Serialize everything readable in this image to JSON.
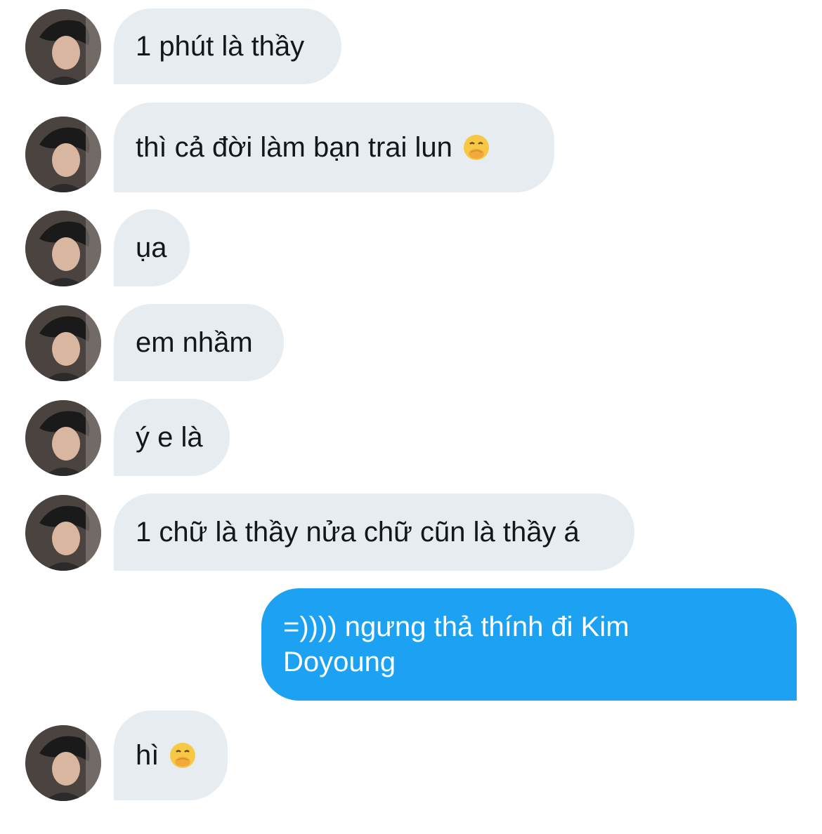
{
  "messages": [
    {
      "sender": "them",
      "text": "1 phút là thầy",
      "emoji": null
    },
    {
      "sender": "them",
      "text": "thì cả đời làm bạn trai lun",
      "emoji": "hand-over-mouth-emoji"
    },
    {
      "sender": "them",
      "text": "ụa",
      "emoji": null
    },
    {
      "sender": "them",
      "text": "em nhầm",
      "emoji": null
    },
    {
      "sender": "them",
      "text": "ý e là",
      "emoji": null
    },
    {
      "sender": "them",
      "text": "1 chữ là thầy nửa chữ cũn là thầy á",
      "emoji": null
    },
    {
      "sender": "me",
      "text": "=)))) ngưng thả thính đi Kim Doyoung",
      "emoji": null
    },
    {
      "sender": "them",
      "text": "hì",
      "emoji": "hand-over-mouth-emoji"
    }
  ],
  "colors": {
    "incoming_bubble": "#e6ecf0",
    "outgoing_bubble": "#1da1f2",
    "incoming_text": "#14171a",
    "outgoing_text": "#ffffff"
  }
}
